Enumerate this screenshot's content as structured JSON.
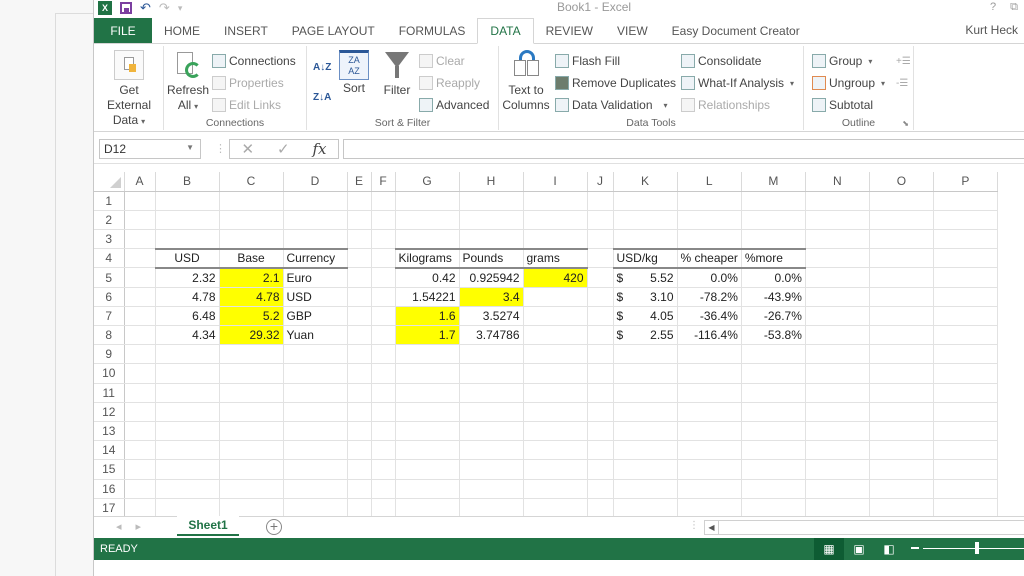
{
  "window": {
    "title": "Book1 - Excel",
    "help": "?",
    "restore": "⧉",
    "user": "Kurt Heck"
  },
  "qat": {
    "logo": "X",
    "undo": "↶",
    "redo": "↷",
    "more": "▾"
  },
  "tabs": [
    {
      "label": "FILE"
    },
    {
      "label": "HOME"
    },
    {
      "label": "INSERT"
    },
    {
      "label": "PAGE LAYOUT"
    },
    {
      "label": "FORMULAS"
    },
    {
      "label": "DATA"
    },
    {
      "label": "REVIEW"
    },
    {
      "label": "VIEW"
    },
    {
      "label": "Easy Document Creator"
    }
  ],
  "ribbon": {
    "get_external": {
      "line1": "Get External",
      "line2": "Data"
    },
    "connections_group": {
      "label": "Connections",
      "refresh_line1": "Refresh",
      "refresh_line2": "All",
      "connections": "Connections",
      "properties": "Properties",
      "edit_links": "Edit Links"
    },
    "sort_filter_group": {
      "label": "Sort & Filter",
      "sort_az": "A↓Z",
      "sort_za": "Z↓A",
      "sort": "Sort",
      "filter": "Filter",
      "clear": "Clear",
      "reapply": "Reapply",
      "advanced": "Advanced"
    },
    "data_tools_group": {
      "label": "Data Tools",
      "text_to_line1": "Text to",
      "text_to_line2": "Columns",
      "flash_fill": "Flash Fill",
      "remove_duplicates": "Remove Duplicates",
      "data_validation": "Data Validation",
      "consolidate": "Consolidate",
      "what_if": "What-If Analysis",
      "relationships": "Relationships"
    },
    "outline_group": {
      "label": "Outline",
      "group": "Group",
      "ungroup": "Ungroup",
      "subtotal": "Subtotal"
    }
  },
  "formula_bar": {
    "name_box": "D12",
    "cancel": "✕",
    "enter": "✓",
    "fx": "fx",
    "value": ""
  },
  "sheet": {
    "columns": [
      "A",
      "B",
      "C",
      "D",
      "E",
      "F",
      "G",
      "H",
      "I",
      "J",
      "K",
      "L",
      "M",
      "N",
      "O",
      "P"
    ],
    "rows": [
      "1",
      "2",
      "3",
      "4",
      "5",
      "6",
      "7",
      "8",
      "9",
      "10",
      "11",
      "12",
      "13",
      "14",
      "15",
      "16",
      "17"
    ],
    "cells": {
      "B4": "USD",
      "C4": "Base",
      "D4": "Currency",
      "B5": "2.32",
      "C5": "2.1",
      "D5": "Euro",
      "B6": "4.78",
      "C6": "4.78",
      "D6": "USD",
      "B7": "6.48",
      "C7": "5.2",
      "D7": "GBP",
      "B8": "4.34",
      "C8": "29.32",
      "D8": "Yuan",
      "G4": "Kilograms",
      "H4": "Pounds",
      "I4": "grams",
      "G5": "0.42",
      "H5": "0.925942",
      "I5": "420",
      "G6": "1.54221",
      "H6": "3.4",
      "G7": "1.6",
      "H7": "3.5274",
      "G8": "1.7",
      "H8": "3.74786",
      "K4": "USD/kg",
      "L4": "% cheaper",
      "M4": "%more",
      "K5": "5.52",
      "L5": "0.0%",
      "M5": "0.0%",
      "K6": "3.10",
      "L6": "-78.2%",
      "M6": "-43.9%",
      "K7": "4.05",
      "L7": "-36.4%",
      "M7": "-26.7%",
      "K8": "2.55",
      "L8": "-116.4%",
      "M8": "-53.8%"
    },
    "currency_symbol": "$",
    "highlight_color": "#ffff00",
    "highlighted_cells": [
      "C5",
      "C6",
      "C7",
      "C8",
      "I5",
      "H6",
      "G7",
      "G8"
    ]
  },
  "sheet_tabs": {
    "nav_prev": "◂",
    "nav_next": "▸",
    "active": "Sheet1",
    "add": "+"
  },
  "status_bar": {
    "status": "READY",
    "accent": "#217346"
  }
}
